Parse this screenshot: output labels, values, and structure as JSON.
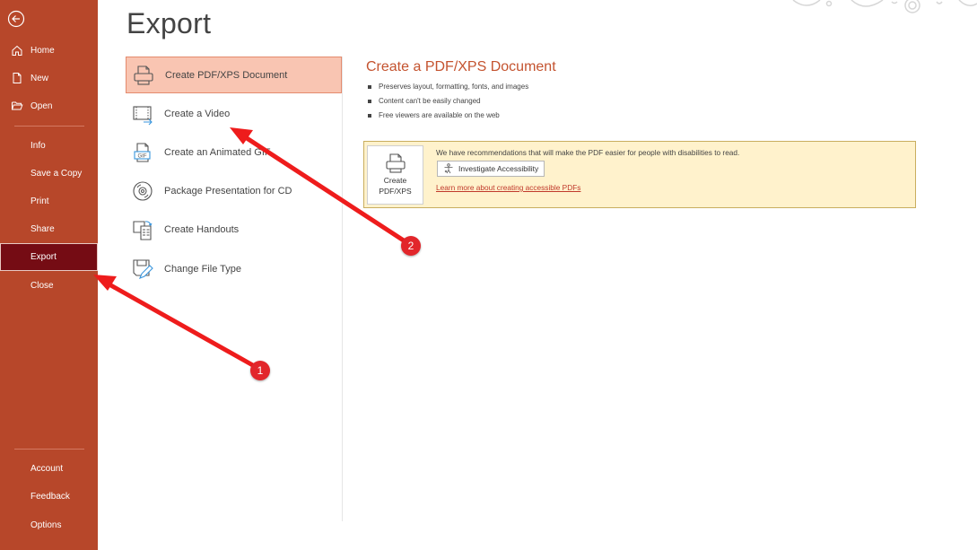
{
  "sidebar": {
    "back_icon": "back-arrow-circle-icon",
    "top_items": [
      {
        "label": "Home",
        "icon": "home-icon"
      },
      {
        "label": "New",
        "icon": "new-document-icon"
      },
      {
        "label": "Open",
        "icon": "folder-open-icon"
      }
    ],
    "middle_items": [
      {
        "label": "Info"
      },
      {
        "label": "Save a Copy"
      },
      {
        "label": "Print"
      },
      {
        "label": "Share"
      },
      {
        "label": "Export",
        "active": true
      },
      {
        "label": "Close"
      }
    ],
    "bottom_items": [
      {
        "label": "Account"
      },
      {
        "label": "Feedback"
      },
      {
        "label": "Options"
      }
    ],
    "colors": {
      "background": "#b7472a",
      "active": "#750c14"
    }
  },
  "page": {
    "title": "Export"
  },
  "export_options": [
    {
      "label": "Create PDF/XPS Document",
      "icon": "pdf-printer-icon",
      "selected": true
    },
    {
      "label": "Create a Video",
      "icon": "video-icon"
    },
    {
      "label": "Create an Animated GIF",
      "icon": "gif-icon"
    },
    {
      "label": "Package Presentation for CD",
      "icon": "cd-icon"
    },
    {
      "label": "Create Handouts",
      "icon": "handouts-icon"
    },
    {
      "label": "Change File Type",
      "icon": "change-file-type-icon"
    }
  ],
  "detail": {
    "title": "Create a PDF/XPS Document",
    "bullets": [
      "Preserves layout, formatting, fonts, and images",
      "Content can't be easily changed",
      "Free viewers are available on the web"
    ],
    "create_button_line1": "Create",
    "create_button_line2": "PDF/XPS",
    "recommendation": "We have recommendations that will make the PDF easier for people with disabilities to read.",
    "investigate_button": "Investigate Accessibility",
    "learn_more_link": "Learn more about creating accessible PDFs",
    "accent_color": "#c4532f"
  },
  "annotations": [
    {
      "number": "1",
      "points_to": "Export"
    },
    {
      "number": "2",
      "points_to": "Create a Video"
    }
  ]
}
